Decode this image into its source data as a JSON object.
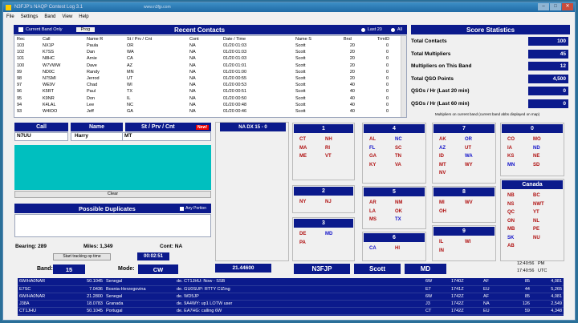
{
  "window": {
    "title": "N3FJP's NAQP Contest Log 3.1",
    "site": "www.n3fjp.com"
  },
  "menu": [
    "File",
    "Settings",
    "Band",
    "View",
    "Help"
  ],
  "recent": {
    "title": "Recent Contacts",
    "current_band_only": "Current Band Only",
    "prog_btn": "Prog",
    "last20": "Last 20",
    "all": "All",
    "headers": [
      "Rec",
      "Call",
      "Name R",
      "St / Prv / Cnt",
      "Cont",
      "Date / Time",
      "Name S",
      "Bnd",
      "TrmID"
    ],
    "rows": [
      [
        "103",
        "NX1P",
        "Paula",
        "OR",
        "NA",
        "01/20 01:03",
        "Scott",
        "20",
        "0"
      ],
      [
        "102",
        "K7SS",
        "Dan",
        "WA",
        "NA",
        "01/20 01:03",
        "Scott",
        "20",
        "0"
      ],
      [
        "101",
        "N8HC",
        "Arnie",
        "CA",
        "NA",
        "01/20 01:03",
        "Scott",
        "20",
        "0"
      ],
      [
        "100",
        "W7VWW",
        "Dave",
        "AZ",
        "NA",
        "01/20 01:01",
        "Scott",
        "20",
        "0"
      ],
      [
        "99",
        "ND0C",
        "Randy",
        "MN",
        "NA",
        "01/20 01:00",
        "Scott",
        "20",
        "0"
      ],
      [
        "98",
        "N7SMI",
        "Jerrod",
        "UT",
        "NA",
        "01/20 00:55",
        "Scott",
        "20",
        "0"
      ],
      [
        "97",
        "WE9V",
        "Chad",
        "WI",
        "NA",
        "01/20 00:53",
        "Scott",
        "40",
        "0"
      ],
      [
        "96",
        "K5RT",
        "Paul",
        "TX",
        "NA",
        "01/20 00:51",
        "Scott",
        "40",
        "0"
      ],
      [
        "95",
        "K9NR",
        "Don",
        "IL",
        "NA",
        "01/20 00:50",
        "Scott",
        "40",
        "0"
      ],
      [
        "94",
        "K4LAL",
        "Lee",
        "NC",
        "NA",
        "01/20 00:48",
        "Scott",
        "40",
        "0"
      ],
      [
        "93",
        "W4IOO",
        "Jeff",
        "GA",
        "NA",
        "01/20 00:46",
        "Scott",
        "40",
        "0"
      ]
    ]
  },
  "stats": {
    "title": "Score Statistics",
    "rows": [
      {
        "label": "Total Contacts",
        "value": "100"
      },
      {
        "label": "Total Multipliers",
        "value": "45"
      },
      {
        "label": "Multipliers on This Band",
        "value": "12"
      },
      {
        "label": "Total QSO Points",
        "value": "4,500"
      },
      {
        "label": "QSOs / Hr (Last 20 min)",
        "value": "0"
      },
      {
        "label": "QSOs / Hr (Last 60 min)",
        "value": "0"
      }
    ],
    "note": "Multipliers on current band (current band abbs displayed on map)"
  },
  "entry": {
    "call_h": "Call",
    "name_h": "Name",
    "st_h": "St / Prv / Cnt",
    "new": "New!",
    "call": "N7UU",
    "name": "Harry",
    "st": "MT",
    "clear": "Clear"
  },
  "dup": {
    "title": "Possible Duplicates",
    "any_portion": "Any Portion"
  },
  "info": {
    "bearing": "Bearing: 289",
    "miles": "Miles: 1,349",
    "cont": "Cont: NA",
    "start_btn": "Start tracking op time",
    "timer": "00:02:51"
  },
  "bottom": {
    "band_l": "Band:",
    "band": "15",
    "mode_l": "Mode:",
    "mode": "CW",
    "freq": "21.44600",
    "mycall": "N3FJP",
    "myname": "Scott",
    "mystate": "MD",
    "t1": "12:40:56",
    "t1z": "PM",
    "t2": "17:40:56",
    "t2z": "UTC"
  },
  "dxhdr": "NA DX 15 - 0",
  "sections": [
    {
      "id": "1",
      "mults": [
        [
          "CT",
          "red"
        ],
        [
          "NH",
          "red"
        ],
        [
          "MA",
          "red"
        ],
        [
          "RI",
          "red"
        ],
        [
          "ME",
          "red"
        ],
        [
          "VT",
          "red"
        ]
      ]
    },
    {
      "id": "2",
      "mults": [
        [
          "NY",
          "red"
        ],
        [
          "NJ",
          "red"
        ]
      ]
    },
    {
      "id": "3",
      "mults": [
        [
          "DE",
          "red"
        ],
        [
          "MD",
          "blue"
        ],
        [
          "PA",
          "red"
        ]
      ]
    },
    {
      "id": "4",
      "mults": [
        [
          "AL",
          "red"
        ],
        [
          "NC",
          "blue"
        ],
        [
          "FL",
          "blue"
        ],
        [
          "SC",
          "red"
        ],
        [
          "GA",
          "red"
        ],
        [
          "TN",
          "red"
        ],
        [
          "KY",
          "red"
        ],
        [
          "VA",
          "red"
        ]
      ]
    },
    {
      "id": "5",
      "mults": [
        [
          "AR",
          "red"
        ],
        [
          "NM",
          "red"
        ],
        [
          "LA",
          "red"
        ],
        [
          "OK",
          "red"
        ],
        [
          "MS",
          "red"
        ],
        [
          "TX",
          "blue"
        ]
      ]
    },
    {
      "id": "6",
      "mults": [
        [
          "CA",
          "blue"
        ],
        [
          "HI",
          "red"
        ]
      ]
    },
    {
      "id": "7",
      "mults": [
        [
          "AK",
          "red"
        ],
        [
          "OR",
          "blue"
        ],
        [
          "AZ",
          "blue"
        ],
        [
          "UT",
          "red"
        ],
        [
          "ID",
          "red"
        ],
        [
          "WA",
          "blue"
        ],
        [
          "MT",
          "red"
        ],
        [
          "WY",
          "red"
        ],
        [
          "NV",
          "red"
        ]
      ]
    },
    {
      "id": "8",
      "mults": [
        [
          "MI",
          "red"
        ],
        [
          "WV",
          "red"
        ],
        [
          "OH",
          "red"
        ]
      ]
    },
    {
      "id": "9",
      "mults": [
        [
          "IL",
          "red"
        ],
        [
          "WI",
          "red"
        ],
        [
          "IN",
          "red"
        ]
      ]
    },
    {
      "id": "0",
      "mults": [
        [
          "CO",
          "red"
        ],
        [
          "MO",
          "red"
        ],
        [
          "IA",
          "red"
        ],
        [
          "ND",
          "blue"
        ],
        [
          "KS",
          "red"
        ],
        [
          "NE",
          "red"
        ],
        [
          "MN",
          "blue"
        ],
        [
          "SD",
          "red"
        ]
      ]
    },
    {
      "id": "Canada",
      "mults": [
        [
          "NB",
          "red"
        ],
        [
          "BC",
          "red"
        ],
        [
          "NS",
          "red"
        ],
        [
          "NWT",
          "red"
        ],
        [
          "QC",
          "red"
        ],
        [
          "YT",
          "red"
        ],
        [
          "ON",
          "red"
        ],
        [
          "NL",
          "red"
        ],
        [
          "MB",
          "red"
        ],
        [
          "PE",
          "red"
        ],
        [
          "SK",
          "blue"
        ],
        [
          "NU",
          "red"
        ],
        [
          "AB",
          "red"
        ]
      ]
    }
  ],
  "dx": [
    [
      "6W/HA0NAR",
      "50.1045",
      "Senegal",
      "de. CT1JHU: Now - SSB",
      "6W",
      "1740Z",
      "AF",
      "85",
      "4,081"
    ],
    [
      "E7SC",
      "7.0436",
      "Bosnia-Herzegovina",
      "de. GU0SUP: RTTY CIZing",
      "E7",
      "1741Z",
      "EU",
      "44",
      "5,265"
    ],
    [
      "6W/HA0NAR",
      "21.2800",
      "Senegal",
      "de. WD5JP",
      "6W",
      "1742Z",
      "AF",
      "85",
      "4,081"
    ],
    [
      "J38A",
      "18.0783",
      "Granada",
      "de. 9A4WY: up1  LOTW user",
      "J3",
      "1742Z",
      "NA",
      "126",
      "2,549"
    ],
    [
      "CT1JHU",
      "50.1045",
      "Portugal",
      "de. EA7HG: calling 6W",
      "CT",
      "1742Z",
      "EU",
      "59",
      "4,348"
    ]
  ]
}
